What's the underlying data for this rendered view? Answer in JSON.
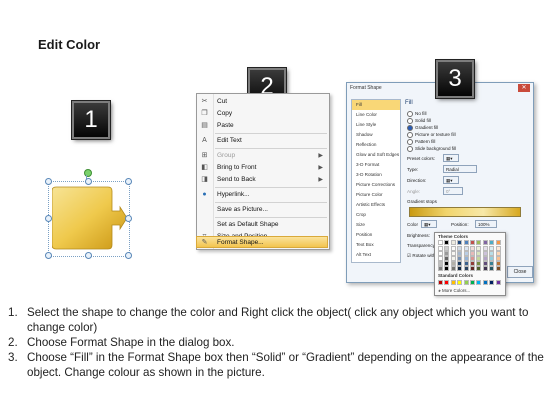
{
  "title": "Edit Color",
  "badges": {
    "step1": "1",
    "step2": "2",
    "step3": "3"
  },
  "colors": {
    "shape_fill_light": "#f3d774",
    "shape_fill_dark": "#c99411",
    "highlight": "#f3c44f"
  },
  "context_menu": {
    "items": [
      {
        "icon": "cut-icon",
        "label": "Cut",
        "enabled": true
      },
      {
        "icon": "copy-icon",
        "label": "Copy",
        "enabled": true
      },
      {
        "icon": "paste-icon",
        "label": "Paste",
        "enabled": true
      },
      {
        "icon": "edit-text-icon",
        "label": "Edit Text",
        "enabled": true
      },
      {
        "icon": "group-icon",
        "label": "Group",
        "enabled": false,
        "submenu": true
      },
      {
        "icon": "bring-front-icon",
        "label": "Bring to Front",
        "enabled": true,
        "submenu": true
      },
      {
        "icon": "send-back-icon",
        "label": "Send to Back",
        "enabled": true,
        "submenu": true
      },
      {
        "icon": "hyperlink-icon",
        "label": "Hyperlink...",
        "enabled": true
      },
      {
        "icon": "",
        "label": "Save as Picture...",
        "enabled": true
      },
      {
        "icon": "",
        "label": "Set as Default Shape",
        "enabled": true
      },
      {
        "icon": "size-position-icon",
        "label": "Size and Position...",
        "enabled": true
      },
      {
        "icon": "format-shape-icon",
        "label": "Format Shape...",
        "enabled": true,
        "highlighted": true
      }
    ]
  },
  "dialog": {
    "title": "Format Shape",
    "categories": [
      "Fill",
      "Line Color",
      "Line Style",
      "Shadow",
      "Reflection",
      "Glow and Soft Edges",
      "3-D Format",
      "3-D Rotation",
      "Picture Corrections",
      "Picture Color",
      "Artistic Effects",
      "Crop",
      "Size",
      "Position",
      "Text Box",
      "Alt Text"
    ],
    "selected_category": "Fill",
    "pane_header": "Fill",
    "fill_options": [
      "No fill",
      "Solid fill",
      "Gradient fill",
      "Picture or texture fill",
      "Pattern fill",
      "Slide background fill"
    ],
    "selected_fill": "Gradient fill",
    "preset_colors_label": "Preset colors:",
    "type_label": "Type:",
    "type_value": "Radial",
    "direction_label": "Direction:",
    "angle_label": "Angle:",
    "angle_value": "0°",
    "gradient_stops_label": "Gradient stops",
    "color_label": "Color",
    "position_label": "Position:",
    "position_value": "100%",
    "brightness_label": "Brightness:",
    "transparency_label": "Transparency:",
    "rotate_label": "Rotate with shape",
    "close_button": "Close"
  },
  "palette": {
    "theme_label": "Theme Colors",
    "standard_label": "Standard Colors",
    "more_label": "More Colors...",
    "theme_top": [
      "#ffffff",
      "#000000",
      "#eeece1",
      "#1f497d",
      "#4f81bd",
      "#c0504d",
      "#9bbb59",
      "#8064a2",
      "#4bacc6",
      "#f79646"
    ],
    "standard": [
      "#c00000",
      "#ff0000",
      "#ffc000",
      "#ffff00",
      "#92d050",
      "#00b050",
      "#00b0f0",
      "#0070c0",
      "#002060",
      "#7030a0"
    ]
  },
  "instructions": [
    "Select the shape to change the color and Right click the object( click any object which you want to change color)",
    "Choose Format Shape in the dialog box.",
    "Choose “Fill” in the Format Shape box then “Solid” or “Gradient” depending on the appearance of the object. Change colour as shown in the picture."
  ]
}
